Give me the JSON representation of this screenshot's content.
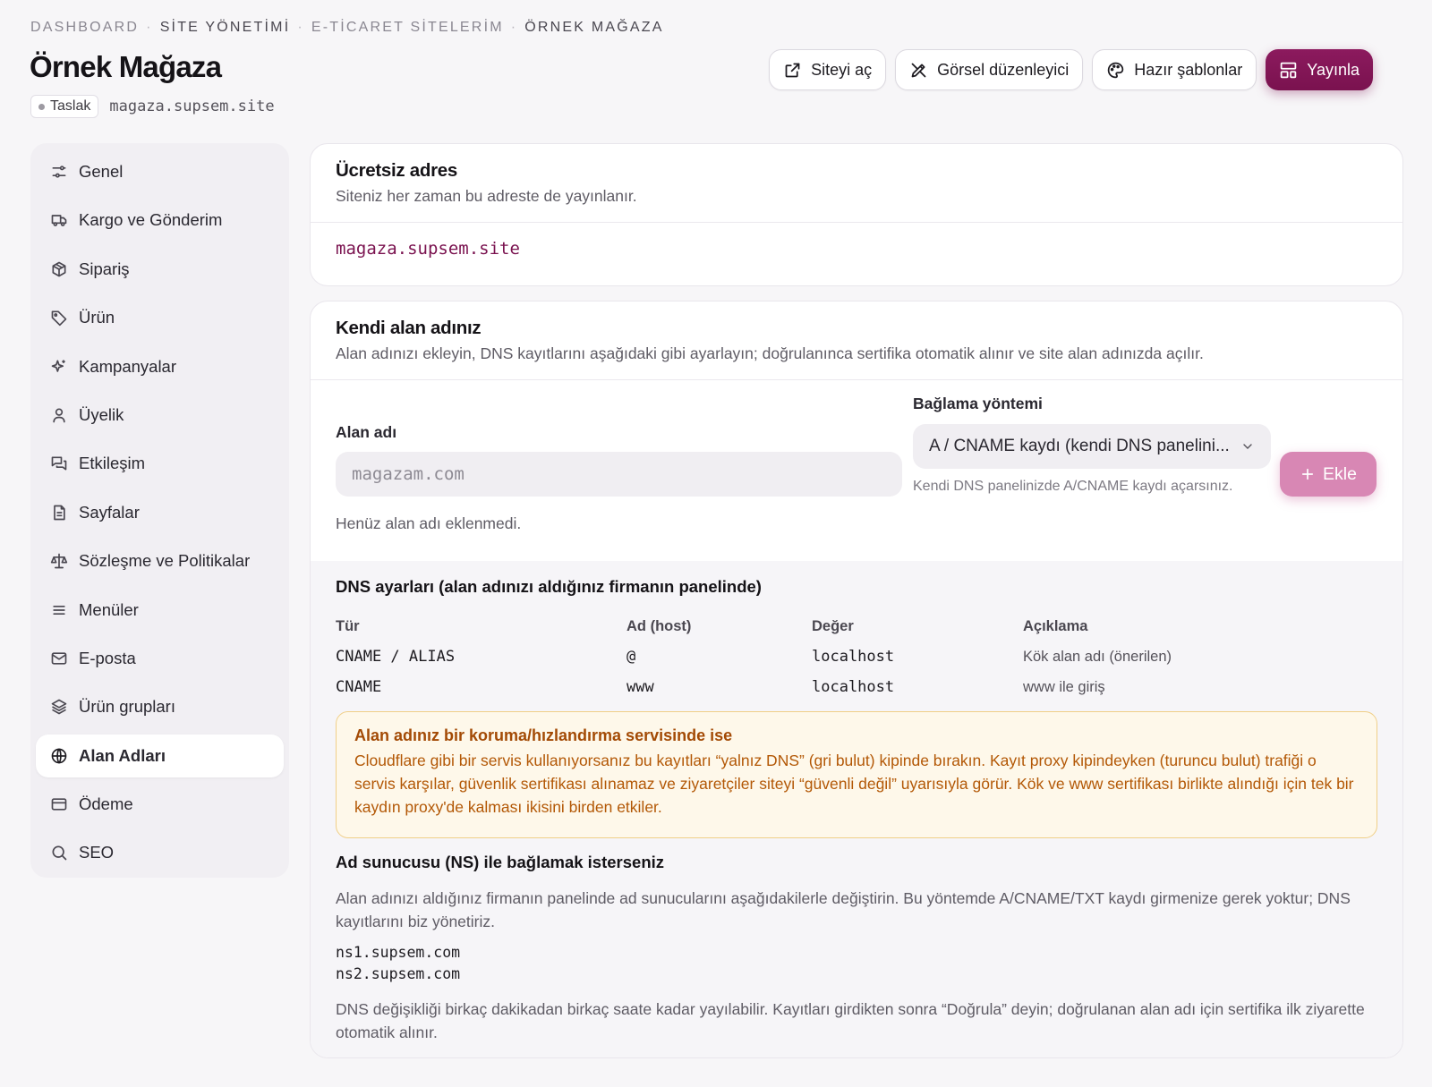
{
  "breadcrumb": [
    "DASHBOARD",
    "SİTE YÖNETİMİ",
    "E-TİCARET SİTELERİM",
    "ÖRNEK MAĞAZA"
  ],
  "page": {
    "title": "Örnek Mağaza",
    "status": "Taslak",
    "domain": "magaza.supsem.site"
  },
  "actions": {
    "open_site": "Siteyi aç",
    "visual_editor": "Görsel düzenleyici",
    "templates": "Hazır şablonlar",
    "publish": "Yayınla"
  },
  "sidebar": {
    "items": [
      {
        "label": "Genel",
        "icon": "sliders-icon"
      },
      {
        "label": "Kargo ve Gönderim",
        "icon": "truck-icon"
      },
      {
        "label": "Sipariş",
        "icon": "package-icon"
      },
      {
        "label": "Ürün",
        "icon": "tag-icon"
      },
      {
        "label": "Kampanyalar",
        "icon": "sparkles-icon"
      },
      {
        "label": "Üyelik",
        "icon": "user-icon"
      },
      {
        "label": "Etkileşim",
        "icon": "chat-icon"
      },
      {
        "label": "Sayfalar",
        "icon": "file-icon"
      },
      {
        "label": "Sözleşme ve Politikalar",
        "icon": "scale-icon"
      },
      {
        "label": "Menüler",
        "icon": "menu-icon"
      },
      {
        "label": "E-posta",
        "icon": "mail-icon"
      },
      {
        "label": "Ürün grupları",
        "icon": "layers-icon"
      },
      {
        "label": "Alan Adları",
        "icon": "globe-icon",
        "active": true
      },
      {
        "label": "Ödeme",
        "icon": "card-icon"
      },
      {
        "label": "SEO",
        "icon": "search-icon"
      }
    ]
  },
  "free_address": {
    "title": "Ücretsiz adres",
    "subtitle": "Siteniz her zaman bu adreste de yayınlanır.",
    "domain": "magaza.supsem.site"
  },
  "custom_domain": {
    "title": "Kendi alan adınız",
    "subtitle": "Alan adınızı ekleyin, DNS kayıtlarını aşağıdaki gibi ayarlayın; doğrulanınca sertifika otomatik alınır ve site alan adınızda açılır.",
    "domain_label": "Alan adı",
    "domain_placeholder": "magazam.com",
    "method_label": "Bağlama yöntemi",
    "method_value": "A / CNAME kaydı (kendi DNS panelini...",
    "method_hint": "Kendi DNS panelinizde A/CNAME kaydı açarsınız.",
    "add_button": "Ekle",
    "empty_note": "Henüz alan adı eklenmedi."
  },
  "dns": {
    "title": "DNS ayarları (alan adınızı aldığınız firmanın panelinde)",
    "headers": [
      "Tür",
      "Ad (host)",
      "Değer",
      "Açıklama"
    ],
    "rows": [
      [
        "CNAME / ALIAS",
        "@",
        "localhost",
        "Kök alan adı (önerilen)"
      ],
      [
        "CNAME",
        "www",
        "localhost",
        "www ile giriş"
      ]
    ]
  },
  "warning": {
    "title": "Alan adınız bir koruma/hızlandırma servisinde ise",
    "body": "Cloudflare gibi bir servis kullanıyorsanız bu kayıtları “yalnız DNS” (gri bulut) kipinde bırakın. Kayıt proxy kipindeyken (turuncu bulut) trafiği o servis karşılar, güvenlik sertifikası alınamaz ve ziyaretçiler siteyi “güvenli değil” uyarısıyla görür. Kök ve www sertifikası birlikte alındığı için tek bir kaydın proxy'de kalması ikisini birden etkiler."
  },
  "nameserver": {
    "title": "Ad sunucusu (NS) ile bağlamak isterseniz",
    "description": "Alan adınızı aldığınız firmanın panelinde ad sunucularını aşağıdakilerle değiştirin. Bu yöntemde A/CNAME/TXT kaydı girmenize gerek yoktur; DNS kayıtlarını biz yönetiriz.",
    "servers": [
      "ns1.supsem.com",
      "ns2.supsem.com"
    ],
    "footer": "DNS değişikliği birkaç dakikadan birkaç saate kadar yayılabilir. Kayıtları girdikten sonra “Doğrula” deyin; doğrulanan alan adı için sertifika ilk ziyarette otomatik alınır."
  }
}
